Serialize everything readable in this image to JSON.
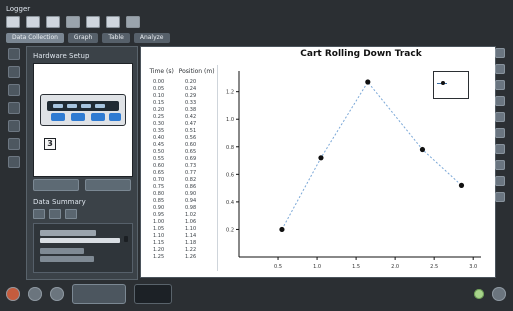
{
  "app": {
    "title": "Logger"
  },
  "tabs": [
    {
      "label": "Data Collection"
    },
    {
      "label": "Graph"
    },
    {
      "label": "Table"
    },
    {
      "label": "Analyze"
    }
  ],
  "left_panel": {
    "hardware_header": "Hardware Setup",
    "device_badge": "3",
    "data_sensors_title": "Data Summary"
  },
  "chart_data": {
    "type": "scatter",
    "title": "Cart Rolling Down Track",
    "xlabel": "",
    "ylabel": "",
    "x": [
      0.0,
      0.5,
      1.0,
      1.5,
      2.0,
      2.5
    ],
    "x_ticks": [
      0.5,
      1.0,
      1.5,
      2.0,
      2.5,
      3.0
    ],
    "series": [
      {
        "name": "",
        "points": [
          {
            "x": 0.55,
            "y": 0.2
          },
          {
            "x": 1.05,
            "y": 0.72
          },
          {
            "x": 1.65,
            "y": 1.27
          },
          {
            "x": 2.35,
            "y": 0.78
          },
          {
            "x": 2.85,
            "y": 0.52
          }
        ]
      }
    ],
    "xlim": [
      0.0,
      3.1
    ],
    "ylim": [
      0.0,
      1.35
    ],
    "y_ticks": [
      0.2,
      0.4,
      0.6,
      0.8,
      1.0,
      1.2
    ],
    "grid": false,
    "legend_position": "top-right"
  },
  "table": {
    "headers": [
      "Time (s)",
      "Position (m)"
    ],
    "rows": [
      [
        "0.00",
        "0.20"
      ],
      [
        "0.05",
        "0.24"
      ],
      [
        "0.10",
        "0.29"
      ],
      [
        "0.15",
        "0.33"
      ],
      [
        "0.20",
        "0.38"
      ],
      [
        "0.25",
        "0.42"
      ],
      [
        "0.30",
        "0.47"
      ],
      [
        "0.35",
        "0.51"
      ],
      [
        "0.40",
        "0.56"
      ],
      [
        "0.45",
        "0.60"
      ],
      [
        "0.50",
        "0.65"
      ],
      [
        "0.55",
        "0.69"
      ],
      [
        "0.60",
        "0.73"
      ],
      [
        "0.65",
        "0.77"
      ],
      [
        "0.70",
        "0.82"
      ],
      [
        "0.75",
        "0.86"
      ],
      [
        "0.80",
        "0.90"
      ],
      [
        "0.85",
        "0.94"
      ],
      [
        "0.90",
        "0.98"
      ],
      [
        "0.95",
        "1.02"
      ],
      [
        "1.00",
        "1.06"
      ],
      [
        "1.05",
        "1.10"
      ],
      [
        "1.10",
        "1.14"
      ],
      [
        "1.15",
        "1.18"
      ],
      [
        "1.20",
        "1.22"
      ],
      [
        "1.25",
        "1.26"
      ]
    ]
  }
}
